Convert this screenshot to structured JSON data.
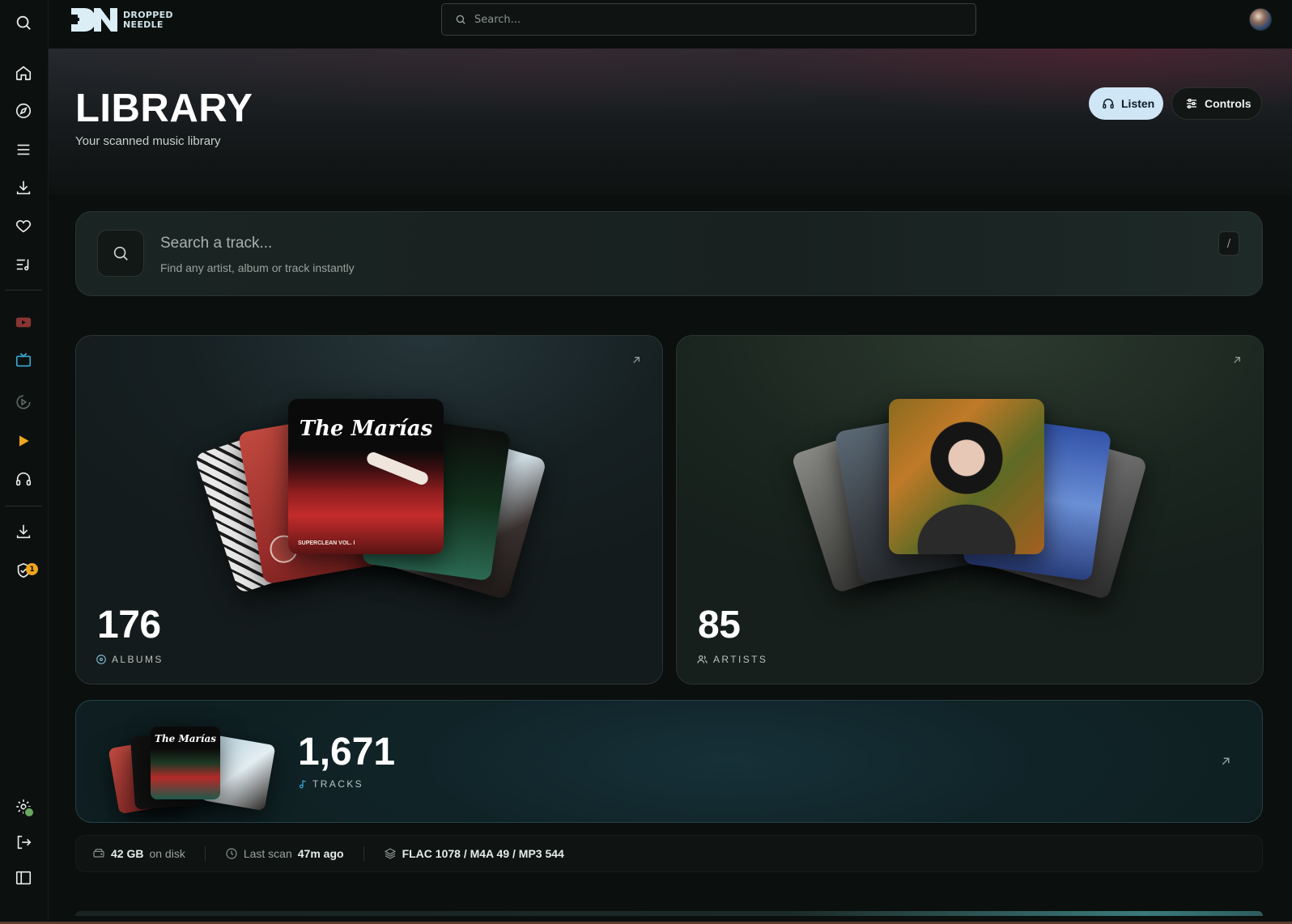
{
  "brand": {
    "name_line1": "DROPPED",
    "name_line2": "NEEDLE"
  },
  "topbar": {
    "search_placeholder": "Search..."
  },
  "page": {
    "title": "LIBRARY",
    "subtitle": "Your scanned music library"
  },
  "actions": {
    "listen_label": "Listen",
    "controls_label": "Controls"
  },
  "track_search": {
    "title": "Search a track...",
    "subtitle": "Find any artist, album or track instantly",
    "shortcut": "/"
  },
  "albums": {
    "count": "176",
    "label": "ALBUMS",
    "featured_cover_title": "The Marías",
    "featured_cover_caption": "SUPERCLEAN VOL. I"
  },
  "artists": {
    "count": "85",
    "label": "ARTISTS"
  },
  "tracks": {
    "count": "1,671",
    "label": "TRACKS",
    "cover_title": "The Marías"
  },
  "stats": {
    "disk_value": "42 GB",
    "disk_suffix": "on disk",
    "last_scan_label": "Last scan",
    "last_scan_value": "47m ago",
    "formats": "FLAC 1078 / M4A 49 / MP3 544"
  },
  "notifications": {
    "security_badge": "1"
  },
  "sidebar_icons": [
    "search-icon",
    "home-icon",
    "compass-icon",
    "menu-icon",
    "download-icon",
    "heart-icon",
    "playlist-icon",
    "youtube-icon",
    "tv-icon",
    "play-history-icon",
    "play-icon",
    "headphones-icon",
    "download-icon",
    "shield-check-icon",
    "settings-icon",
    "logout-icon",
    "panel-toggle-icon"
  ],
  "colors": {
    "accent_blue": "#cfe6f6",
    "tv_icon": "#3aa7d6",
    "play_icon": "#f0a51f",
    "youtube_icon": "#c64a4a",
    "badge": "#f0a51f"
  }
}
